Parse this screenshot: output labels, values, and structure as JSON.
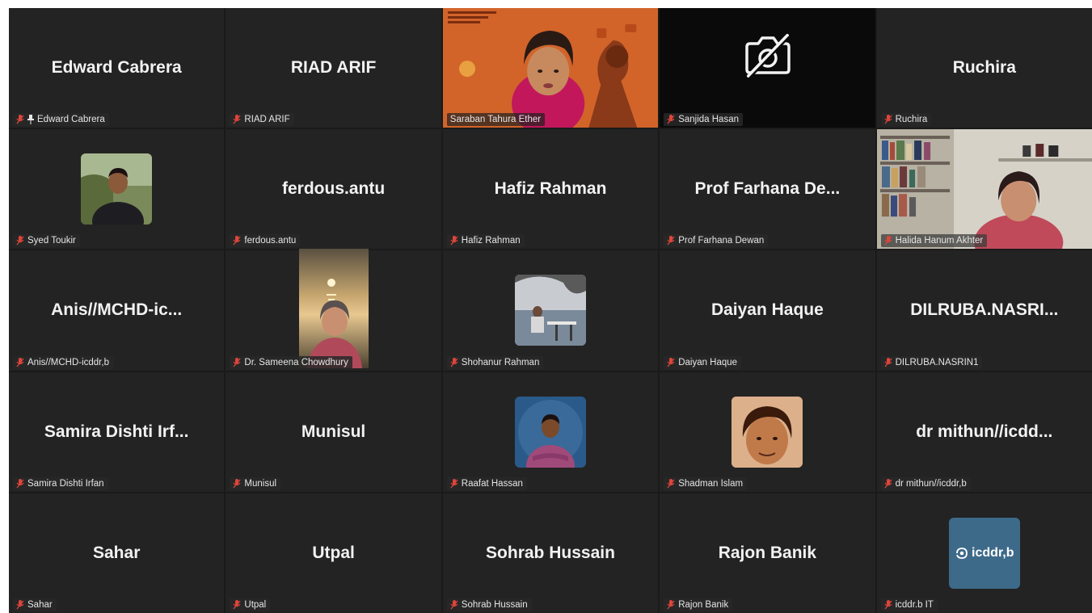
{
  "meeting": {
    "participants": [
      {
        "big_name": "Edward Cabrera",
        "label": "Edward Cabrera",
        "pinned": true
      },
      {
        "big_name": "RIAD ARIF",
        "label": "RIAD ARIF"
      },
      {
        "label": "Saraban Tahura Ether",
        "video": "slide-presenter",
        "active_speaker": true
      },
      {
        "label": "Sanjida Hasan",
        "video": "camera-off"
      },
      {
        "big_name": "Ruchira",
        "label": "Ruchira"
      },
      {
        "label": "Syed Toukir",
        "avatar": "photo-man-outdoor"
      },
      {
        "big_name": "ferdous.antu",
        "label": "ferdous.antu"
      },
      {
        "big_name": "Hafiz Rahman",
        "label": "Hafiz Rahman"
      },
      {
        "big_name": "Prof Farhana De...",
        "label": "Prof Farhana Dewan"
      },
      {
        "label": "Halida Hanum Akhter",
        "video": "bookshelf-room"
      },
      {
        "big_name": "Anis//MCHD-ic...",
        "label": "Anis//MCHD-icddr,b"
      },
      {
        "label": "Dr. Sameena Chowdhury",
        "avatar": "photo-sunset-woman"
      },
      {
        "label": "Shohanur Rahman",
        "avatar": "photo-seaside"
      },
      {
        "big_name": "Daiyan Haque",
        "label": "Daiyan Haque"
      },
      {
        "big_name": "DILRUBA.NASRI...",
        "label": "DILRUBA.NASRIN1"
      },
      {
        "big_name": "Samira Dishti Irf...",
        "label": "Samira Dishti Irfan"
      },
      {
        "big_name": "Munisul",
        "label": "Munisul"
      },
      {
        "label": "Raafat Hassan",
        "avatar": "photo-man-blue"
      },
      {
        "label": "Shadman Islam",
        "avatar": "photo-sepia-face"
      },
      {
        "big_name": "dr mithun//icdd...",
        "label": "dr mithun//icddr,b"
      },
      {
        "big_name": "Sahar",
        "label": "Sahar"
      },
      {
        "big_name": "Utpal",
        "label": "Utpal"
      },
      {
        "big_name": "Sohrab Hussain",
        "label": "Sohrab Hussain"
      },
      {
        "big_name": "Rajon Banik",
        "label": "Rajon Banik"
      },
      {
        "label": "icddr.b IT",
        "avatar": "icddrb-logo",
        "avatar_text": "icddr,b"
      }
    ]
  },
  "colors": {
    "tile_bg": "#232323",
    "active_border": "#2ecc71",
    "mute_red": "#e0453a"
  }
}
